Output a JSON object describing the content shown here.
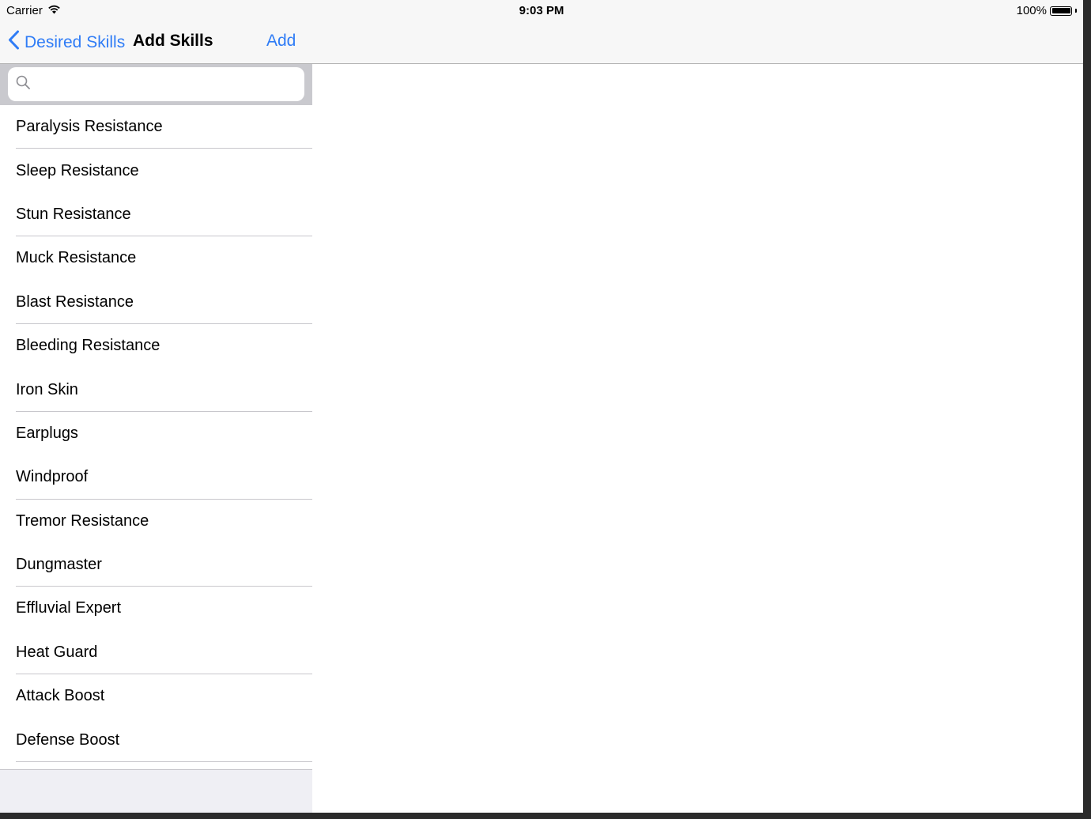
{
  "status_bar": {
    "carrier": "Carrier",
    "time": "9:03 PM",
    "battery": "100%"
  },
  "nav": {
    "back_label": "Desired Skills",
    "title": "Add Skills",
    "add_label": "Add"
  },
  "search": {
    "placeholder": "",
    "value": ""
  },
  "skills": [
    {
      "label": "Paralysis Resistance"
    },
    {
      "label": "Sleep Resistance"
    },
    {
      "label": "Stun Resistance"
    },
    {
      "label": "Muck Resistance"
    },
    {
      "label": "Blast Resistance"
    },
    {
      "label": "Bleeding Resistance"
    },
    {
      "label": "Iron Skin"
    },
    {
      "label": "Earplugs"
    },
    {
      "label": "Windproof"
    },
    {
      "label": "Tremor Resistance"
    },
    {
      "label": "Dungmaster"
    },
    {
      "label": "Effluvial Expert"
    },
    {
      "label": "Heat Guard"
    },
    {
      "label": "Attack Boost"
    },
    {
      "label": "Defense Boost"
    }
  ],
  "colors": {
    "accent": "#2f7cf6",
    "bar_background": "#f7f7f7",
    "search_background": "#c9c9ce",
    "separator": "#c8c7cc"
  }
}
